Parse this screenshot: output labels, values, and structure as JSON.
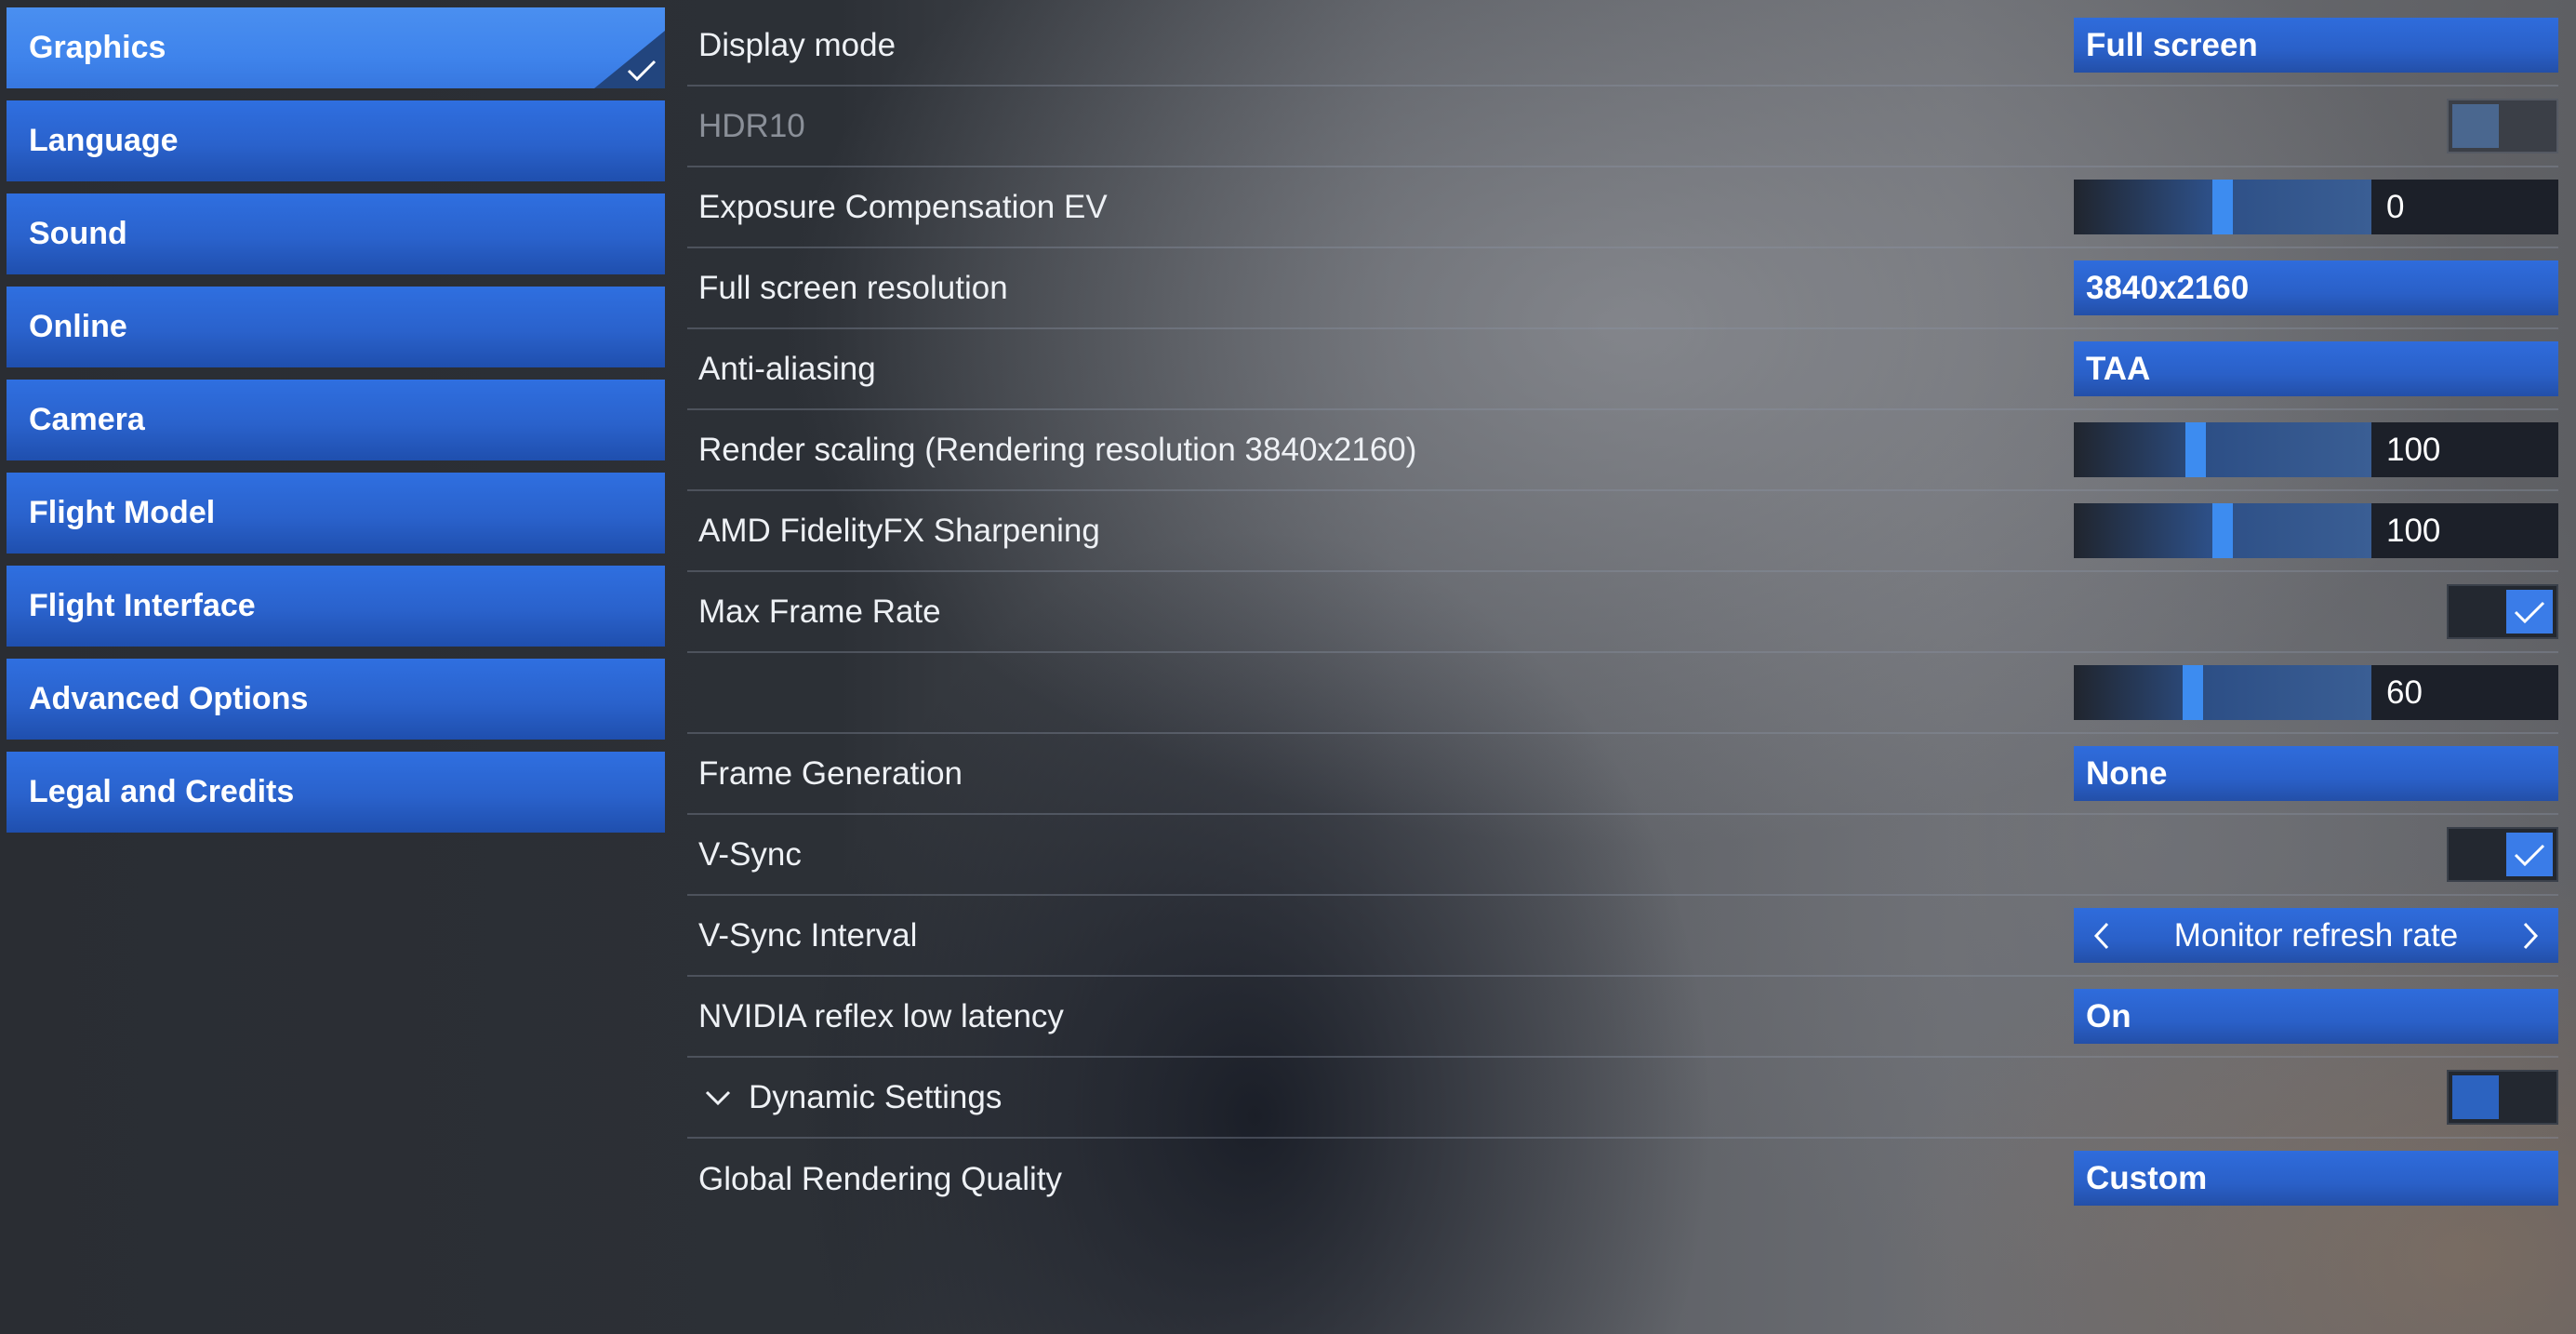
{
  "sidebar": {
    "items": [
      {
        "label": "Graphics",
        "active": true
      },
      {
        "label": "Language"
      },
      {
        "label": "Sound"
      },
      {
        "label": "Online"
      },
      {
        "label": "Camera"
      },
      {
        "label": "Flight Model"
      },
      {
        "label": "Flight Interface"
      },
      {
        "label": "Advanced Options"
      },
      {
        "label": "Legal and Credits"
      }
    ]
  },
  "settings": {
    "display_mode": {
      "label": "Display mode",
      "value": "Full screen"
    },
    "hdr10": {
      "label": "HDR10",
      "checked": false,
      "disabled": true
    },
    "exposure": {
      "label": "Exposure Compensation EV",
      "value": "0",
      "level": 0.5
    },
    "resolution": {
      "label": "Full screen resolution",
      "value": "3840x2160"
    },
    "anti_aliasing": {
      "label": "Anti-aliasing",
      "value": "TAA"
    },
    "render_scaling": {
      "label": "Render scaling (Rendering resolution 3840x2160)",
      "value": "100",
      "level": 0.41
    },
    "sharpening": {
      "label": "AMD FidelityFX Sharpening",
      "value": "100",
      "level": 0.5
    },
    "max_frame_rate": {
      "label": "Max Frame Rate",
      "checked": true
    },
    "frame_rate_limit": {
      "value": "60",
      "level": 0.4
    },
    "frame_generation": {
      "label": "Frame Generation",
      "value": "None"
    },
    "vsync": {
      "label": "V-Sync",
      "checked": true
    },
    "vsync_interval": {
      "label": "V-Sync Interval",
      "value": "Monitor refresh rate"
    },
    "reflex": {
      "label": "NVIDIA reflex low latency",
      "value": "On"
    },
    "dynamic_settings": {
      "label": "Dynamic Settings",
      "checked": false
    },
    "global_quality": {
      "label": "Global Rendering Quality",
      "value": "Custom"
    }
  },
  "colors": {
    "accent": "#3d8cf0",
    "button_blue": "#2a60c8",
    "active_tab": "#3f84ec"
  },
  "icons": [
    "checkmark-icon",
    "chevron-left-icon",
    "chevron-right-icon",
    "chevron-down-icon"
  ]
}
